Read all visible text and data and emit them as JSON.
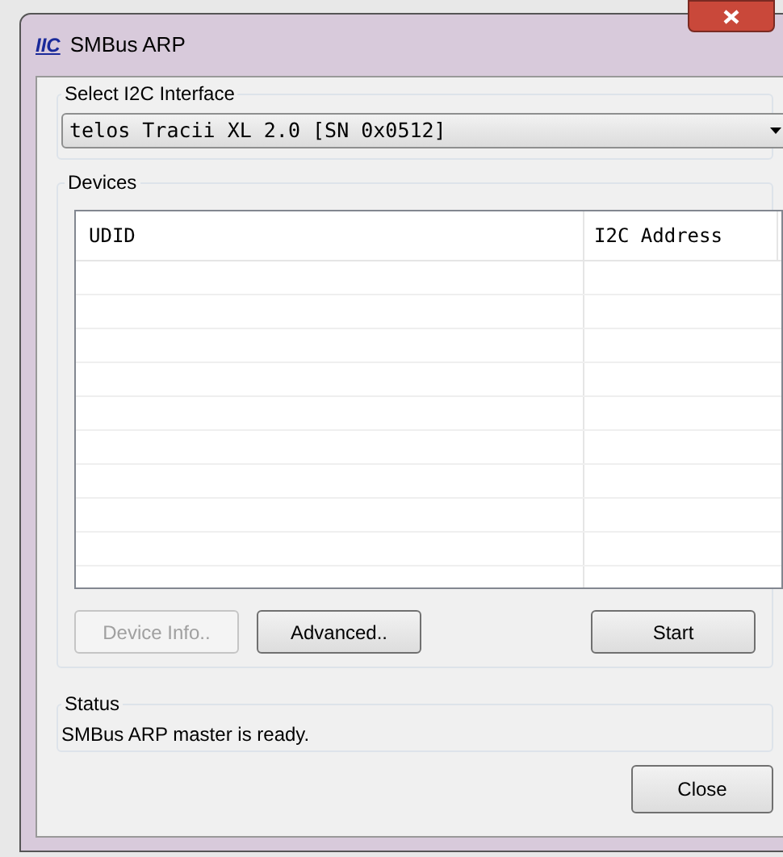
{
  "window": {
    "title": "SMBus ARP",
    "logo": "IIC"
  },
  "interface_group": {
    "label": "Select I2C Interface",
    "value": "telos Tracii XL 2.0 [SN 0x0512]"
  },
  "devices_group": {
    "label": "Devices",
    "columns": [
      "UDID",
      "I2C Address"
    ]
  },
  "buttons": [
    {
      "label": "Device Info..",
      "disabled": true
    },
    {
      "label": "Advanced..",
      "disabled": false
    },
    {
      "label": "Start",
      "disabled": false
    }
  ],
  "status_group": {
    "label": "Status",
    "message": "SMBus ARP master is ready."
  },
  "close_button": "Close"
}
